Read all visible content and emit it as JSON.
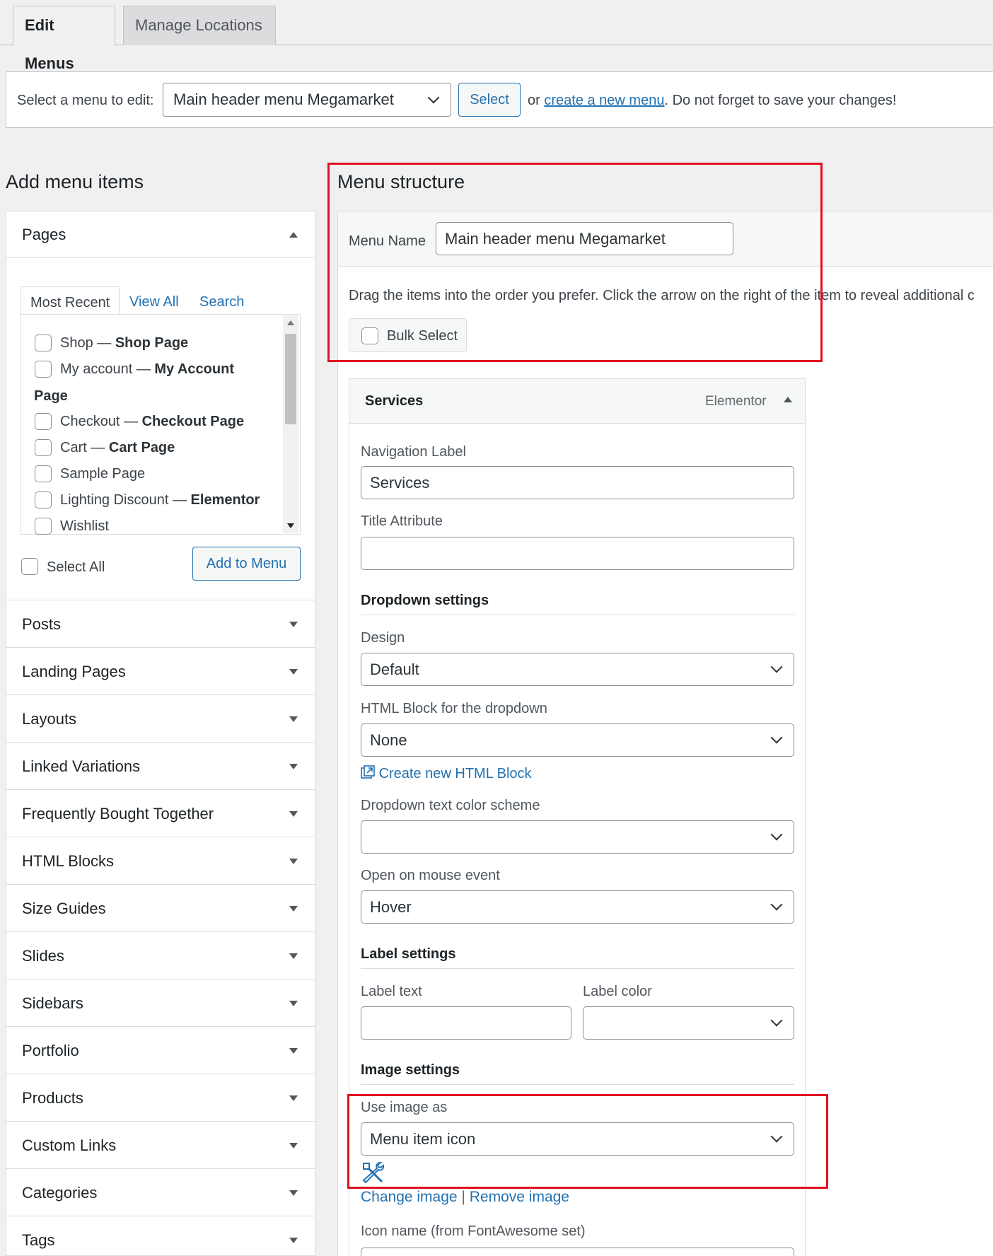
{
  "tabs": {
    "edit_menus": "Edit Menus",
    "manage_locations": "Manage Locations"
  },
  "select_bar": {
    "label": "Select a menu to edit:",
    "selected_menu": "Main header menu Megamarket",
    "select_button": "Select",
    "or_text": "or",
    "create_link": "create a new menu",
    "trailing_text": ". Do not forget to save your changes!"
  },
  "add_items": {
    "heading": "Add menu items",
    "pages": {
      "title": "Pages",
      "tabs": [
        "Most Recent",
        "View All",
        "Search"
      ],
      "items": [
        {
          "label": "Shop — ",
          "bold": "Shop Page"
        },
        {
          "label": "My account — ",
          "bold": "My Account"
        },
        {
          "label": "",
          "bold": "Page"
        },
        {
          "label": "Checkout — ",
          "bold": "Checkout Page"
        },
        {
          "label": "Cart — ",
          "bold": "Cart Page"
        },
        {
          "label": "Sample Page",
          "bold": ""
        },
        {
          "label": "Lighting Discount — ",
          "bold": "Elementor"
        },
        {
          "label": "Wishlist",
          "bold": ""
        }
      ],
      "select_all": "Select All",
      "add_to_menu": "Add to Menu"
    },
    "sections": [
      "Posts",
      "Landing Pages",
      "Layouts",
      "Linked Variations",
      "Frequently Bought Together",
      "HTML Blocks",
      "Size Guides",
      "Slides",
      "Sidebars",
      "Portfolio",
      "Products",
      "Custom Links",
      "Categories",
      "Tags"
    ]
  },
  "structure": {
    "heading": "Menu structure",
    "menu_name_label": "Menu Name",
    "menu_name_value": "Main header menu Megamarket",
    "instructions": "Drag the items into the order you prefer. Click the arrow on the right of the item to reveal additional c",
    "bulk_select": "Bulk Select",
    "item": {
      "title": "Services",
      "type": "Elementor",
      "nav_label_label": "Navigation Label",
      "nav_label_value": "Services",
      "title_attr_label": "Title Attribute",
      "title_attr_value": "",
      "dropdown_settings": "Dropdown settings",
      "design_label": "Design",
      "design_value": "Default",
      "html_block_label": "HTML Block for the dropdown",
      "html_block_value": "None",
      "create_html_block": "Create new HTML Block",
      "text_color_label": "Dropdown text color scheme",
      "text_color_value": "",
      "mouse_event_label": "Open on mouse event",
      "mouse_event_value": "Hover",
      "label_settings": "Label settings",
      "label_text_label": "Label text",
      "label_color_label": "Label color",
      "image_settings": "Image settings",
      "use_image_label": "Use image as",
      "use_image_value": "Menu item icon",
      "change_image": "Change image",
      "separator": "|",
      "remove_image": "Remove image",
      "icon_name_label": "Icon name (from FontAwesome set)"
    }
  },
  "colors": {
    "accent": "#2271b1",
    "highlight": "#e0121f"
  }
}
